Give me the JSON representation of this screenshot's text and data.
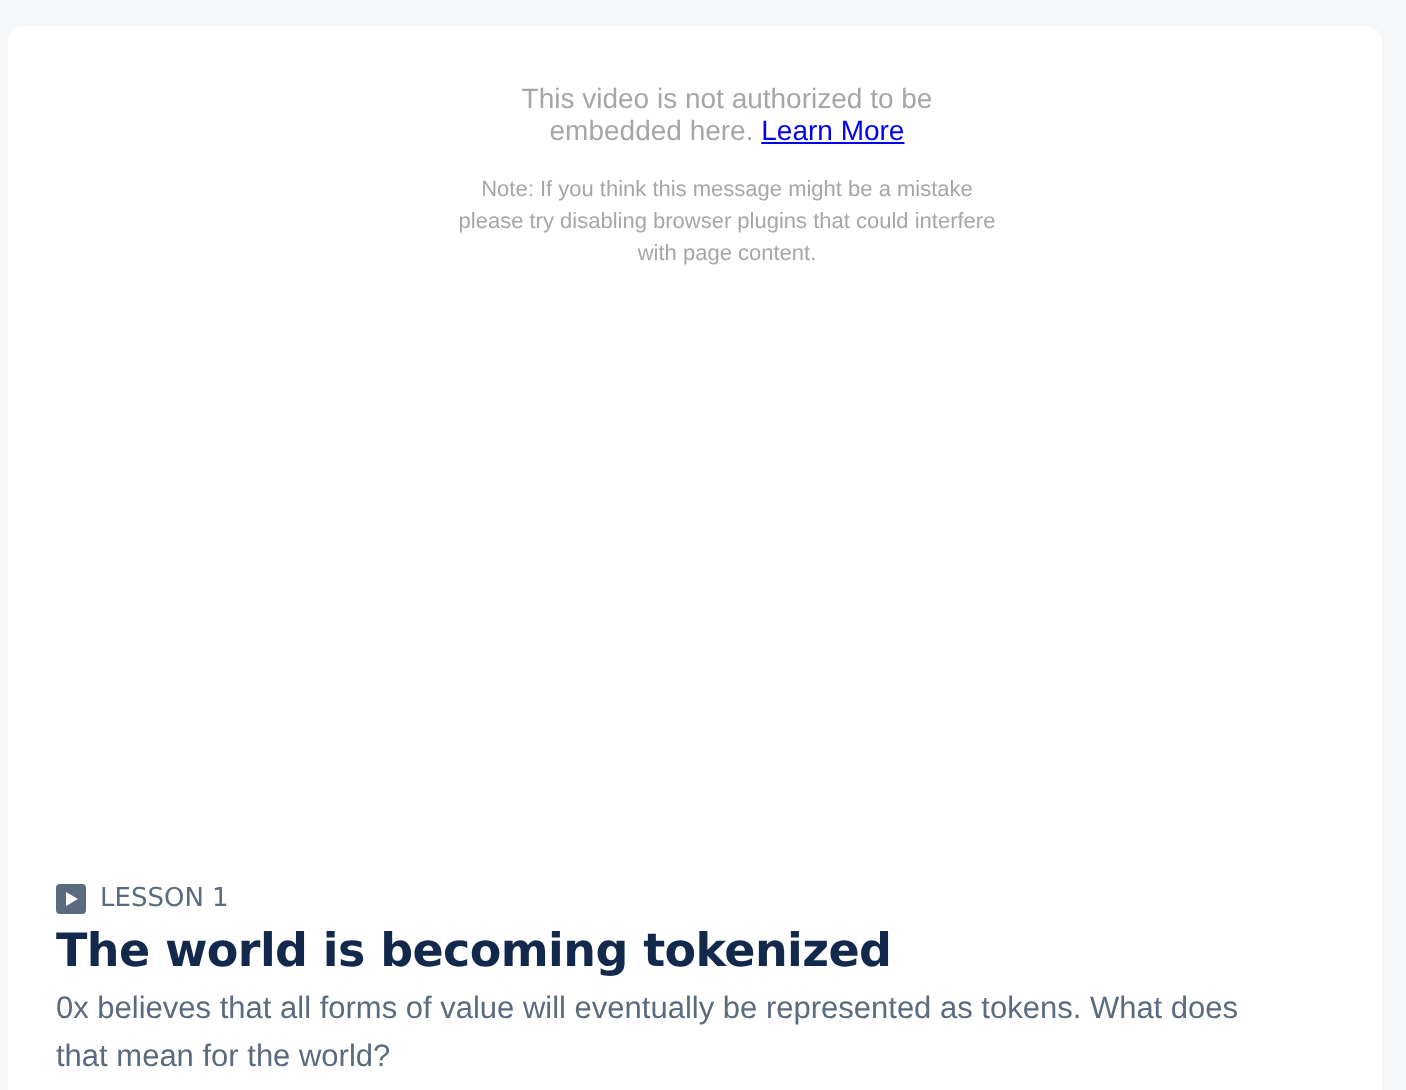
{
  "video": {
    "message": "This video is not authorized to be embedded here.",
    "link": "Learn More",
    "note": "Note: If you think this message might be a mistake please try disabling browser plugins that could interfere with page content."
  },
  "lesson": {
    "label": "LESSON 1",
    "title": "The world is becoming tokenized",
    "description": "0x believes that all forms of value will eventually be represented as tokens. What does that mean for the world?"
  }
}
